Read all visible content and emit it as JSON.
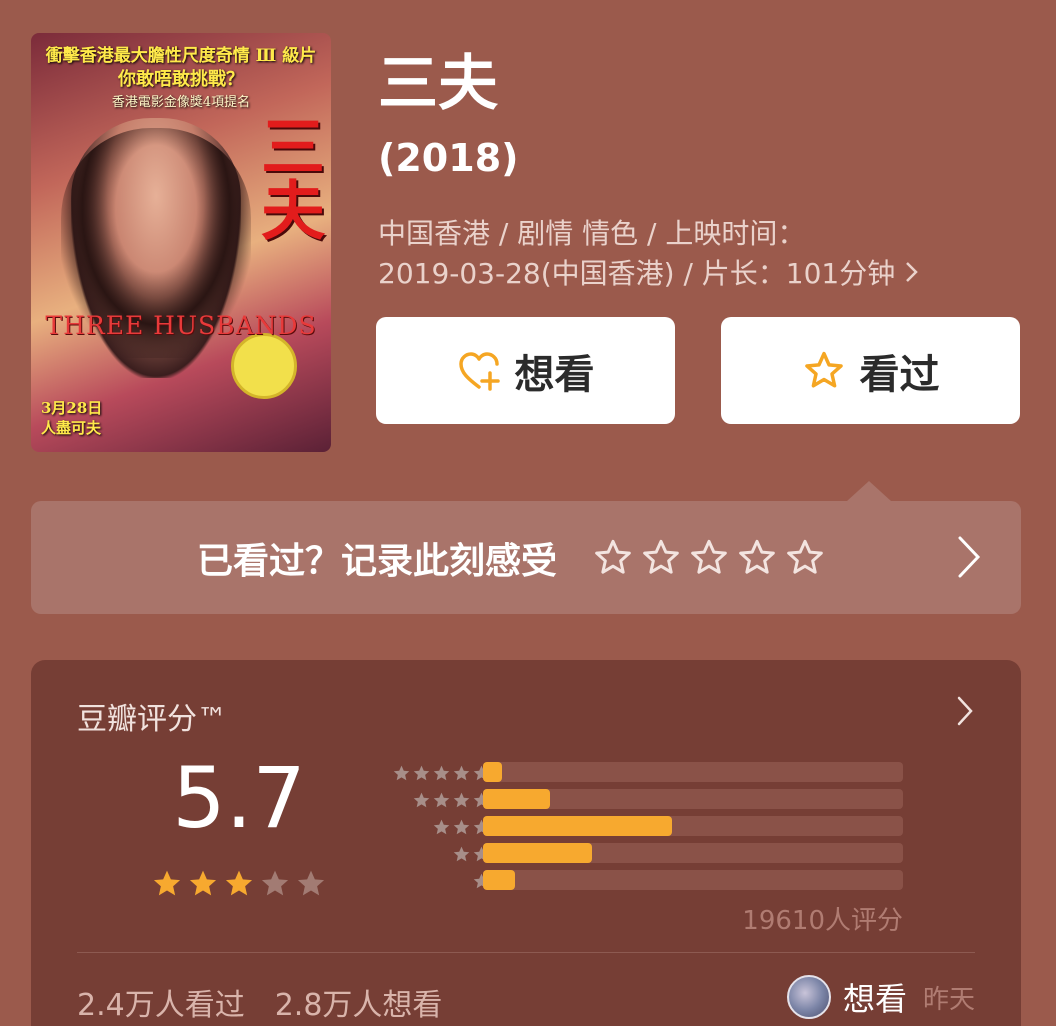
{
  "poster": {
    "tagline1": "衝擊香港最大膽性尺度奇情 Ⅲ 級片",
    "tagline2": "你敢唔敢挑戰？",
    "tagline3": "香港電影金像獎4項提名",
    "big_title": "三夫",
    "en_title": "THREE HUSBANDS",
    "date": "3月28日",
    "date_sub": "人盡可夫"
  },
  "movie": {
    "title": "三夫",
    "year": "(2018)",
    "meta_line1": "中国香港 / 剧情 情色 / 上映时间：",
    "meta_line2": "2019-03-28(中国香港) / 片长：101分钟"
  },
  "buttons": {
    "want": "想看",
    "seen": "看过"
  },
  "rate_banner": {
    "prompt": "已看过？记录此刻感受",
    "star_count": 5
  },
  "rating": {
    "label": "豆瓣评分™",
    "score": "5.7",
    "stars_filled": 3,
    "stars_total": 5,
    "distribution": [
      {
        "stars": 5,
        "fraction": 0.045
      },
      {
        "stars": 4,
        "fraction": 0.16
      },
      {
        "stars": 3,
        "fraction": 0.45
      },
      {
        "stars": 2,
        "fraction": 0.26
      },
      {
        "stars": 1,
        "fraction": 0.075
      }
    ],
    "count": "19610人评分",
    "watched": "2.4万人看过",
    "wanted": "2.8万人想看",
    "friend_action": "想看",
    "friend_time": "昨天"
  },
  "colors": {
    "background": "#9b5a4c",
    "accent": "#f7a92f",
    "card": "#763e35"
  }
}
